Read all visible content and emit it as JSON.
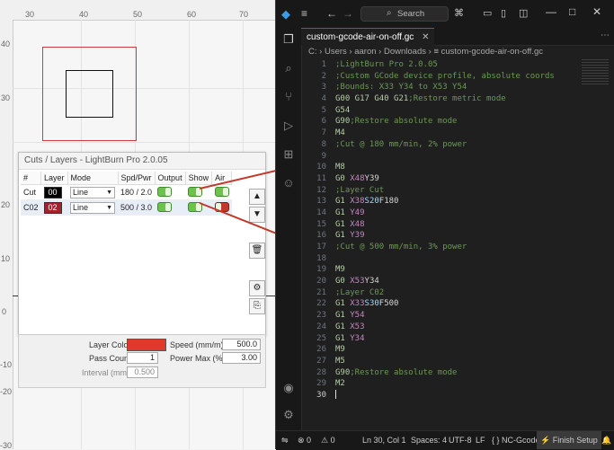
{
  "workspace": {
    "x_ticks": [
      "30",
      "40",
      "50",
      "60",
      "70"
    ],
    "y_ticks": [
      "40",
      "30",
      "20",
      "10",
      "0",
      "-10",
      "-20",
      "-30"
    ]
  },
  "cuts_window": {
    "title": "Cuts / Layers - LightBurn Pro 2.0.05",
    "headers": [
      "#",
      "Layer",
      "Mode",
      "Spd/Pwr",
      "Output",
      "Show",
      "Air"
    ],
    "rows": [
      {
        "num": "Cut",
        "layer": "00",
        "mode": "Line",
        "spdpwr": "180 / 2.0",
        "color": "#000000"
      },
      {
        "num": "C02",
        "layer": "02",
        "mode": "Line",
        "spdpwr": "500 / 3.0",
        "color": "#a3232d"
      }
    ]
  },
  "props": {
    "layer_color_label": "Layer Color",
    "layer_color": "#e0392c",
    "speed_label": "Speed (mm/m)",
    "speed": "500.0",
    "pass_count_label": "Pass Count",
    "pass_count": "1",
    "power_max_label": "Power Max (%)",
    "power_max": "3.00",
    "interval_label": "Interval (mm)",
    "interval": "0.500"
  },
  "vscode": {
    "search_placeholder": "Search",
    "tab_label": "custom-gcode-air-on-off.gc",
    "breadcrumb": [
      "C:",
      "Users",
      "aaron",
      "Downloads",
      "custom-gcode-air-on-off.gc"
    ],
    "status": {
      "errors": "0",
      "warnings": "0",
      "cursor": "Ln 30, Col 1",
      "spaces": "Spaces: 4",
      "encoding": "UTF-8",
      "eol": "LF",
      "language": "NC-Gcode",
      "finish": "Finish Setup"
    }
  },
  "code_lines": [
    [
      [
        "c",
        ";LightBurn Pro 2.0.05"
      ]
    ],
    [
      [
        "c",
        ";Custom GCode device profile, absolute coords"
      ]
    ],
    [
      [
        "c",
        ";Bounds: X33 Y34 to X53 Y54"
      ]
    ],
    [
      [
        "n",
        "G00 G17 G40 G21"
      ],
      [
        "c",
        ";Restore metric mode"
      ]
    ],
    [
      [
        "n",
        "G54"
      ]
    ],
    [
      [
        "n",
        "G90"
      ],
      [
        "c",
        ";Restore absolute mode"
      ]
    ],
    [
      [
        "n",
        "M4"
      ]
    ],
    [
      [
        "c",
        ";Cut @ 180 mm/min, 2% power"
      ]
    ],
    [],
    [
      [
        "n",
        "M8"
      ]
    ],
    [
      [
        "n",
        "G0 "
      ],
      [
        "k",
        "X48"
      ],
      [
        "t",
        "Y39"
      ]
    ],
    [
      [
        "c",
        ";Layer Cut"
      ]
    ],
    [
      [
        "n",
        "G1 "
      ],
      [
        "k",
        "X38"
      ],
      [
        "a",
        "S20"
      ],
      [
        "t",
        "F180"
      ]
    ],
    [
      [
        "n",
        "G1 "
      ],
      [
        "k",
        "Y49"
      ]
    ],
    [
      [
        "n",
        "G1 "
      ],
      [
        "k",
        "X48"
      ]
    ],
    [
      [
        "n",
        "G1 "
      ],
      [
        "k",
        "Y39"
      ]
    ],
    [
      [
        "c",
        ";Cut @ 500 mm/min, 3% power"
      ]
    ],
    [],
    [
      [
        "n",
        "M9"
      ]
    ],
    [
      [
        "n",
        "G0 "
      ],
      [
        "k",
        "X53"
      ],
      [
        "t",
        "Y34"
      ]
    ],
    [
      [
        "c",
        ";Layer C02"
      ]
    ],
    [
      [
        "n",
        "G1 "
      ],
      [
        "k",
        "X33"
      ],
      [
        "a",
        "S30"
      ],
      [
        "t",
        "F500"
      ]
    ],
    [
      [
        "n",
        "G1 "
      ],
      [
        "k",
        "Y54"
      ]
    ],
    [
      [
        "n",
        "G1 "
      ],
      [
        "k",
        "X53"
      ]
    ],
    [
      [
        "n",
        "G1 "
      ],
      [
        "k",
        "Y34"
      ]
    ],
    [
      [
        "n",
        "M9"
      ]
    ],
    [
      [
        "n",
        "M5"
      ]
    ],
    [
      [
        "n",
        "G90"
      ],
      [
        "c",
        ";Restore absolute mode"
      ]
    ],
    [
      [
        "n",
        "M2"
      ]
    ],
    []
  ],
  "current_line": 30
}
